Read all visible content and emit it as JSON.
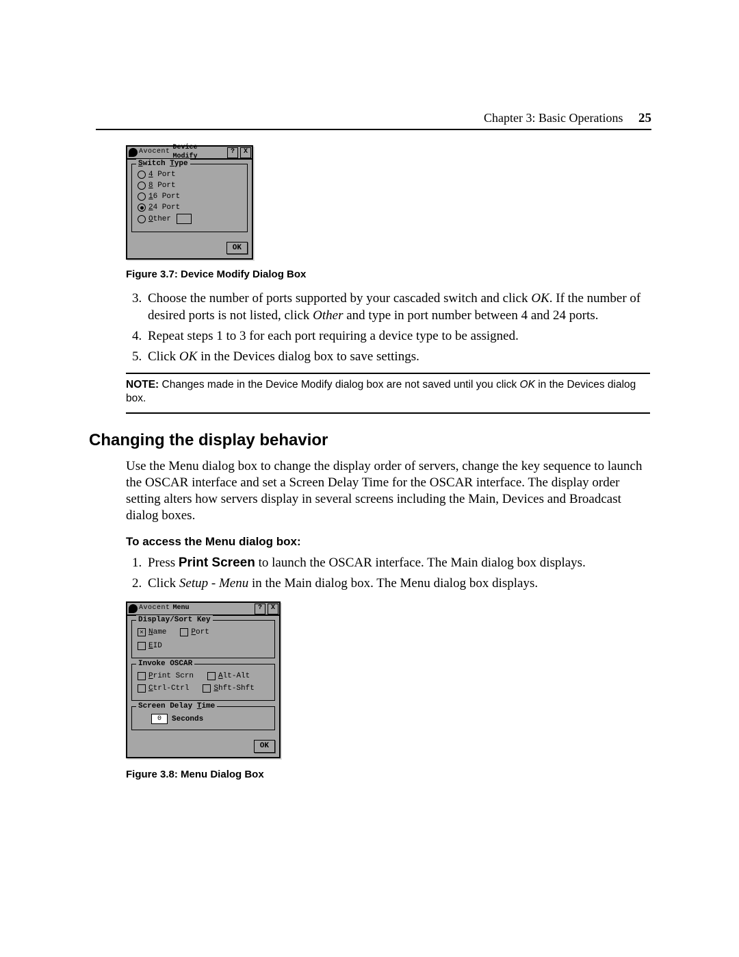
{
  "header": {
    "chapter": "Chapter 3: Basic Operations",
    "page": "25"
  },
  "dialog1": {
    "brand": "Avocent",
    "title": "Device Modify",
    "help": "?",
    "close": "X",
    "group": "Switch Type",
    "opts": [
      {
        "hot": "4",
        "rest": " Port",
        "sel": false
      },
      {
        "hot": "8",
        "rest": " Port",
        "sel": false
      },
      {
        "hot": "1",
        "rest": "6 Port",
        "sel": false
      },
      {
        "hot": "2",
        "rest": "4 Port",
        "sel": true
      },
      {
        "hot": "O",
        "rest": "ther",
        "sel": false,
        "other": true
      }
    ],
    "ok": "OK"
  },
  "caption1": "Figure 3.7: Device Modify Dialog Box",
  "steps1": {
    "s3_a": "Choose the number of ports supported by your cascaded switch and click ",
    "s3_ok": "OK",
    "s3_b": ". If the number of desired ports is not listed, click ",
    "s3_other": "Other",
    "s3_c": " and type in port number between 4 and 24 ports.",
    "s4": "Repeat steps 1 to 3 for each port requiring a device type to be assigned.",
    "s5_a": "Click ",
    "s5_ok": "OK",
    "s5_b": " in the Devices dialog box to save settings."
  },
  "note": {
    "label": "NOTE:",
    "a": " Changes made in the Device Modify dialog box are not saved until you click ",
    "ok": "OK",
    "b": " in the Devices dialog box."
  },
  "section": "Changing the display behavior",
  "para": "Use the Menu dialog box to change the display order of servers, change the key sequence to launch the OSCAR interface and set a Screen Delay Time for the OSCAR interface. The display order setting alters how servers display in several screens including the Main, Devices and Broadcast dialog boxes.",
  "subhead": "To access the Menu dialog box:",
  "steps2": {
    "s1_a": "Press ",
    "s1_bold": "Print Screen",
    "s1_b": " to launch the OSCAR interface. The Main dialog box displays.",
    "s2_a": "Click ",
    "s2_ital": "Setup - Menu",
    "s2_b": " in the Main dialog box. The Menu dialog box displays."
  },
  "dialog2": {
    "brand": "Avocent",
    "title": "Menu",
    "help": "?",
    "close": "X",
    "g1": "Display/Sort Key",
    "g1_opts_l": {
      "hot": "N",
      "rest": "ame",
      "sel": true
    },
    "g1_opts_r": {
      "hot": "P",
      "rest": "ort",
      "sel": false
    },
    "g1_opts_b": {
      "hot": "E",
      "rest": "ID",
      "sel": false
    },
    "g2": "Invoke OSCAR",
    "g2_l1l": {
      "hot": "P",
      "rest": "rint Scrn",
      "sel": false
    },
    "g2_l1r": {
      "hot": "A",
      "rest": "lt-Alt",
      "sel": false
    },
    "g2_l2l": {
      "hot": "C",
      "rest": "trl-Ctrl",
      "sel": false
    },
    "g2_l2r": {
      "hot": "S",
      "rest": "hft-Shft",
      "sel": false
    },
    "g3": "Screen Delay ",
    "g3_hot": "T",
    "g3_rest": "ime",
    "delay": "0",
    "seconds": "Seconds",
    "ok": "OK"
  },
  "caption2": "Figure 3.8: Menu Dialog Box"
}
